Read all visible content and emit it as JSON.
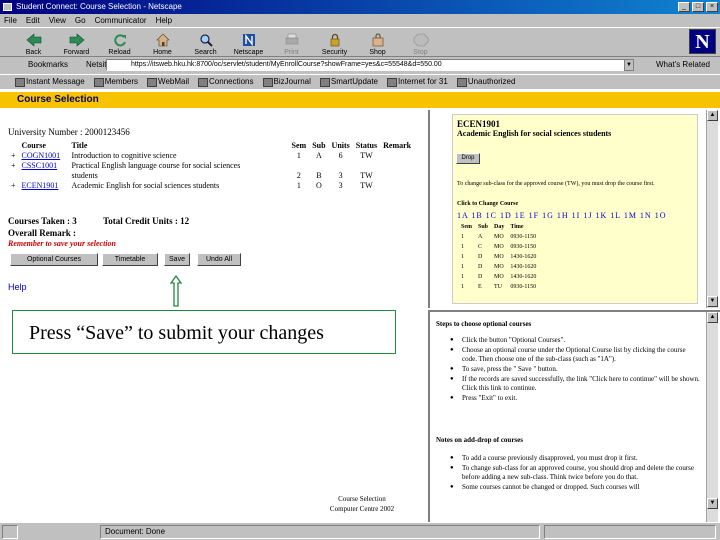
{
  "window": {
    "title": "Student Connect: Course Selection - Netscape",
    "controls": [
      "_",
      "□",
      "×"
    ]
  },
  "menubar": [
    "File",
    "Edit",
    "View",
    "Go",
    "Communicator",
    "Help"
  ],
  "toolbar": [
    "Back",
    "Forward",
    "Reload",
    "Home",
    "Search",
    "Netscape",
    "Print",
    "Security",
    "Shop",
    "Stop"
  ],
  "location": {
    "bookmarks_label": "Bookmarks",
    "label": "Netsite:",
    "url": "https://itsweb.hku.hk:8700/oc/servlet/student/MyEnrollCourse?showFrame=yes&c=55548&d=550.00",
    "related": "What's Related"
  },
  "personal_bar": [
    "Instant Message",
    "Members",
    "WebMail",
    "Connections",
    "BizJournal",
    "SmartUpdate",
    "Internet for 31",
    "Unauthorized"
  ],
  "page": {
    "header": "Course Selection",
    "university_number": "University Number : 2000123456",
    "columns": [
      "Course",
      "Title",
      "Sem",
      "Sub",
      "Units",
      "Status",
      "Remark"
    ],
    "rows": [
      {
        "mark": "+",
        "course": "COGN1001",
        "title": [
          "Introduction to cognitive science"
        ],
        "sem": "1",
        "sub": "A",
        "units": "6",
        "status": "TW"
      },
      {
        "mark": "+",
        "course": "CSSC1001",
        "title": [
          "Practical English language course for social sciences",
          "students"
        ],
        "sem": "2",
        "sub": "B",
        "units": "3",
        "status": "TW"
      },
      {
        "mark": "+",
        "course": "ECEN1901",
        "title": [
          "Academic English for social sciences students"
        ],
        "sem": "1",
        "sub": "O",
        "units": "3",
        "status": "TW"
      }
    ],
    "courses_taken": "Courses Taken : 3",
    "total_credits": "Total Credit Units : 12",
    "overall_remark": "Overall Remark :",
    "remember": "Remember to save your selection",
    "buttons": {
      "optional": "Optional Courses",
      "timetable": "Timetable",
      "save": "Save",
      "undo": "Undo All"
    },
    "help": "Help",
    "callout": "Press “Save” to submit your changes",
    "footer": [
      "Course Selection",
      "Computer Centre 2002"
    ]
  },
  "detail": {
    "code": "ECEN1901",
    "title": "Academic English for social sciences students",
    "drop": "Drop",
    "note": "To change sub-class for the approved course (TW), you must drop the course first.",
    "click_label": "Click to Change Course",
    "subclasses": "1A 1B 1C 1D 1E 1F 1G 1H 1I 1J 1K 1L 1M 1N 1O",
    "sched_head": [
      "Sem",
      "Sub",
      "Day",
      "Time"
    ],
    "sched_rows": [
      [
        "1",
        "A",
        "MO",
        "0930-1150"
      ],
      [
        "1",
        "C",
        "MO",
        "0930-1150"
      ],
      [
        "1",
        "D",
        "MO",
        "1430-1620"
      ],
      [
        "1",
        "D",
        "MO",
        "1430-1620"
      ],
      [
        "1",
        "D",
        "MO",
        "1430-1620"
      ],
      [
        "1",
        "E",
        "TU",
        "0930-1150"
      ]
    ]
  },
  "steps": {
    "heading": "Steps to choose optional courses",
    "items": [
      "Click the button \"Optional Courses\".",
      "Choose an optional course under the Optional Course list by clicking the course code. Then choose one of the sub-class (such as \"1A\").",
      "To save, press the \" Save \" button.",
      "If the records are saved successfully, the link \"Click here to continue\" will be shown. Click this link to continue.",
      "Press \"Exit\" to exit."
    ]
  },
  "notes": {
    "heading": "Notes on add-drop of courses",
    "items": [
      "To add a course previously disapproved, you must drop it first.",
      "To change sub-class for an approved course, you should drop and delete the course before adding a new sub-class. Think twice before you do that.",
      "Some courses cannot be changed or dropped. Such courses will"
    ]
  },
  "status": {
    "text": "Document: Done"
  },
  "colors": {
    "header_bar": "#f7c300",
    "link": "#0000cc",
    "callout_border": "#1e8a3c",
    "arrow": "#1e8a3c",
    "detail_bg": "#ffffcc"
  }
}
